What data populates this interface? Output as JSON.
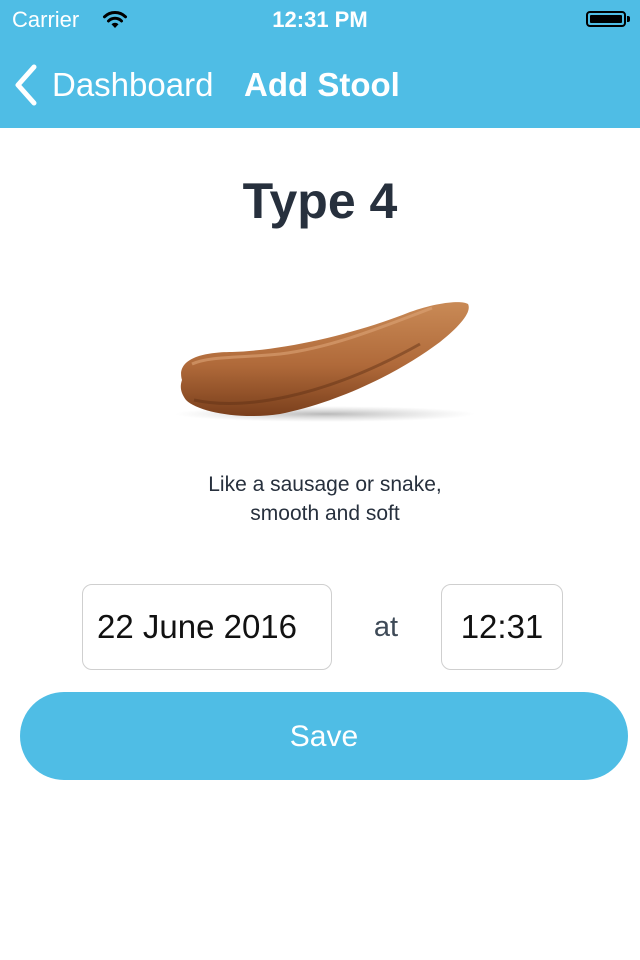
{
  "status_bar": {
    "carrier": "Carrier",
    "time": "12:31 PM",
    "icons": [
      "wifi-icon",
      "battery-icon"
    ]
  },
  "nav": {
    "back_label": "Dashboard",
    "title": "Add Stool",
    "back_icon": "chevron-left-icon"
  },
  "stool": {
    "type_heading": "Type 4",
    "description_line1": "Like a sausage or snake,",
    "description_line2": "smooth and soft",
    "image_icon": "stool-type-4-illustration"
  },
  "form": {
    "date_value": "22 June 2016",
    "at_label": "at",
    "time_value": "12:31",
    "save_label": "Save"
  },
  "colors": {
    "accent": "#4fbde5",
    "heading_text": "#27303d",
    "stool_brown": "#b06a3a"
  }
}
